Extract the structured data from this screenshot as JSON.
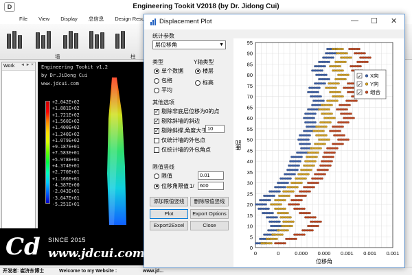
{
  "app": {
    "title": "Engineering Tookit V2018 (by Dr. Jidong Cui)",
    "logo_text": "D",
    "menu": [
      "File",
      "View",
      "Display",
      "总信息",
      "Design Results",
      "Al"
    ],
    "toolbar_labels": [
      "墙",
      "柱"
    ],
    "side_tab": "Work",
    "side_controls": "◄ ► ×"
  },
  "canvas": {
    "lines": [
      "Engineering Tookit v1.2",
      "by Dr.JiDong Cui",
      "www.jdcui.com"
    ],
    "legend": [
      "+2.042E+02",
      "+1.881E+02",
      "+1.721E+02",
      "+1.560E+02",
      "+1.400E+02",
      "+1.240E+02",
      "+1.079E+02",
      "+9.187E+01",
      "+7.583E+01",
      "+5.978E+01",
      "+4.374E+01",
      "+2.770E+01",
      "+1.166E+01",
      "-4.387E+00",
      "-2.043E+01",
      "-3.647E+01",
      "-5.251E+01"
    ]
  },
  "banner": {
    "logo": "Cd",
    "since": "SINCE 2015",
    "url": "www.jdcui.com"
  },
  "status": {
    "developer": "开发者: 崔济东博士",
    "welcome": "Welcome to my Website :",
    "site": "www.jd..."
  },
  "dialog": {
    "title": "Displacement Plot",
    "controls": {
      "minimize": "—",
      "maximize": "☐",
      "close": "✕"
    },
    "stat_group": "统计参数",
    "stat_value": "层位移角",
    "type_group": "类型",
    "type_options": [
      "单个数据",
      "包络",
      "平均"
    ],
    "y_group": "Y轴类型",
    "y_options": [
      "楼层",
      "标高"
    ],
    "other_group": "其他选项",
    "other_options": [
      {
        "label": "剔除非底层位移为0的点",
        "checked": true
      },
      {
        "label": "剔除斜墙的斜边",
        "checked": true
      },
      {
        "label": "剔除斜撑,角度大于",
        "checked": true
      },
      {
        "label": "仅统计墙的外包点",
        "checked": false
      },
      {
        "label": "仅统计墙的外包角点",
        "checked": false
      }
    ],
    "angle_value": "10",
    "limit_group": "限值竖线",
    "limit_opt1": "限值",
    "limit_opt1_value": "0.01",
    "limit_opt2": "位移角限值",
    "limit_prefix": "1/",
    "limit_opt2_value": "600",
    "buttons": {
      "add_limit": "添加限值竖线",
      "del_limit": "删除限值竖线",
      "plot": "Plot",
      "export_options": "Export Options",
      "export_excel": "Export2Excel",
      "close": "Close"
    }
  },
  "chart_data": {
    "type": "scatter",
    "xlabel": "位移角",
    "ylabel": "楼层",
    "xlim": [
      0,
      0.001
    ],
    "ylim": [
      0,
      95
    ],
    "x_ticks": [
      "0",
      "0",
      "0.000",
      "0.000",
      "0.001",
      "0.001",
      "0.001"
    ],
    "y_ticks": [
      95,
      90,
      85,
      80,
      75,
      70,
      65,
      60,
      55,
      50,
      45,
      40,
      35,
      30,
      25,
      20,
      15,
      10,
      5,
      0
    ],
    "grid": true,
    "legend_position": "top-right",
    "series": [
      {
        "name": "X向",
        "color": "#3b5fa8",
        "floors": [
          92,
          90,
          88,
          86,
          84,
          82,
          80,
          78,
          76,
          74,
          72,
          70,
          68,
          66,
          64,
          62,
          60,
          58,
          56,
          54,
          52,
          50,
          48,
          46,
          44,
          42,
          40,
          38,
          36,
          34,
          32,
          30,
          28,
          26,
          24,
          22,
          20,
          18,
          16,
          14,
          12,
          10,
          8,
          6,
          4,
          2
        ],
        "values": [
          0.00056,
          0.00055,
          0.00053,
          0.0005,
          0.00047,
          0.00045,
          0.00048,
          0.0005,
          0.00047,
          0.00043,
          0.00042,
          0.00044,
          0.00046,
          0.00045,
          0.00042,
          0.0004,
          0.00039,
          0.0004,
          0.00041,
          0.00039,
          0.00036,
          0.00035,
          0.00036,
          0.00037,
          0.00034,
          0.0003,
          0.00029,
          0.00028,
          0.00027,
          0.00025,
          0.00022,
          0.0002,
          0.00018,
          0.00014,
          0.0001,
          7e-05,
          4e-05,
          6e-05,
          9e-05,
          0.00012,
          0.00014,
          0.00015,
          0.00013,
          0.0001,
          7e-05,
          4e-05
        ]
      },
      {
        "name": "Y向",
        "color": "#d4a020",
        "floors": [
          92,
          90,
          88,
          86,
          84,
          82,
          80,
          78,
          76,
          74,
          72,
          70,
          68,
          66,
          64,
          62,
          60,
          58,
          56,
          54,
          52,
          50,
          48,
          46,
          44,
          42,
          40,
          38,
          36,
          34,
          32,
          30,
          28,
          26,
          24,
          22,
          20,
          18,
          16,
          14,
          12,
          10,
          8,
          6,
          4,
          2
        ],
        "values": [
          0.0006,
          0.00063,
          0.00066,
          0.00062,
          0.00058,
          0.0006,
          0.00064,
          0.00062,
          0.00057,
          0.00055,
          0.00058,
          0.0006,
          0.00056,
          0.00052,
          0.0005,
          0.00052,
          0.00054,
          0.00051,
          0.00048,
          0.00046,
          0.00048,
          0.0005,
          0.00047,
          0.00044,
          0.00042,
          0.00041,
          0.0004,
          0.00039,
          0.00037,
          0.00035,
          0.00033,
          0.0003,
          0.00027,
          0.00024,
          0.00021,
          0.00018,
          0.00015,
          0.00018,
          0.0002,
          0.00022,
          0.00024,
          0.00023,
          0.0002,
          0.00016,
          0.00012,
          8e-05
        ]
      },
      {
        "name": "组合",
        "color": "#c0461e",
        "floors": [
          92,
          90,
          88,
          86,
          84,
          82,
          80,
          78,
          76,
          74,
          72,
          70,
          68,
          66,
          64,
          62,
          60,
          58,
          56,
          54,
          52,
          50,
          48,
          46,
          44,
          42,
          40,
          38,
          36,
          34,
          32,
          30,
          28,
          26,
          24,
          22,
          20,
          18,
          16,
          14,
          12,
          10,
          8,
          6,
          4,
          2
        ],
        "values": [
          0.00072,
          0.00076,
          0.0008,
          0.00078,
          0.00073,
          0.00074,
          0.00079,
          0.00077,
          0.00071,
          0.00068,
          0.00071,
          0.00074,
          0.0007,
          0.00065,
          0.00063,
          0.00066,
          0.00068,
          0.00064,
          0.0006,
          0.00058,
          0.00061,
          0.00064,
          0.0006,
          0.00056,
          0.00054,
          0.00053,
          0.00052,
          0.00051,
          0.00049,
          0.00047,
          0.00045,
          0.00042,
          0.00039,
          0.00036,
          0.00033,
          0.0003,
          0.00028,
          0.00032,
          0.00036,
          0.0004,
          0.00044,
          0.00042,
          0.00038,
          0.00032,
          0.00026,
          0.00018
        ]
      }
    ]
  }
}
